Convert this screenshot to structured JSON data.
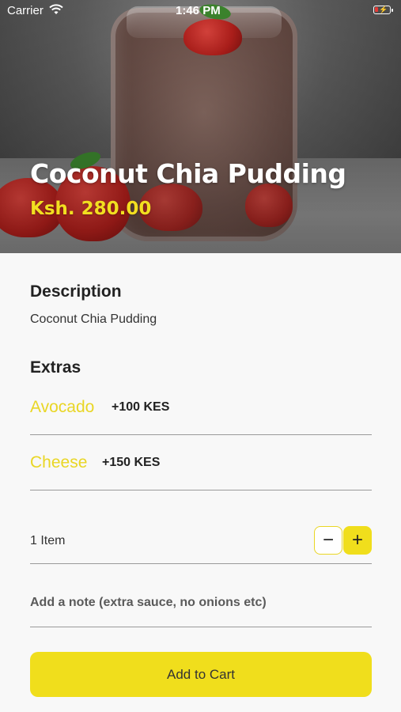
{
  "status_bar": {
    "carrier": "Carrier",
    "time": "1:46 PM"
  },
  "product": {
    "title": "Coconut Chia Pudding",
    "price": "Ksh. 280.00"
  },
  "description": {
    "heading": "Description",
    "text": "Coconut Chia Pudding"
  },
  "extras": {
    "heading": "Extras",
    "items": [
      {
        "name": "Avocado",
        "price": "+100 KES"
      },
      {
        "name": "Cheese",
        "price": "+150 KES"
      }
    ]
  },
  "quantity": {
    "label": "1 Item",
    "minus": "−",
    "plus": "+"
  },
  "note": {
    "placeholder": "Add a note (extra sauce, no onions etc)"
  },
  "cart": {
    "button_label": "Add to Cart"
  },
  "colors": {
    "accent": "#f0de1c",
    "extra_name": "#e9d624"
  }
}
